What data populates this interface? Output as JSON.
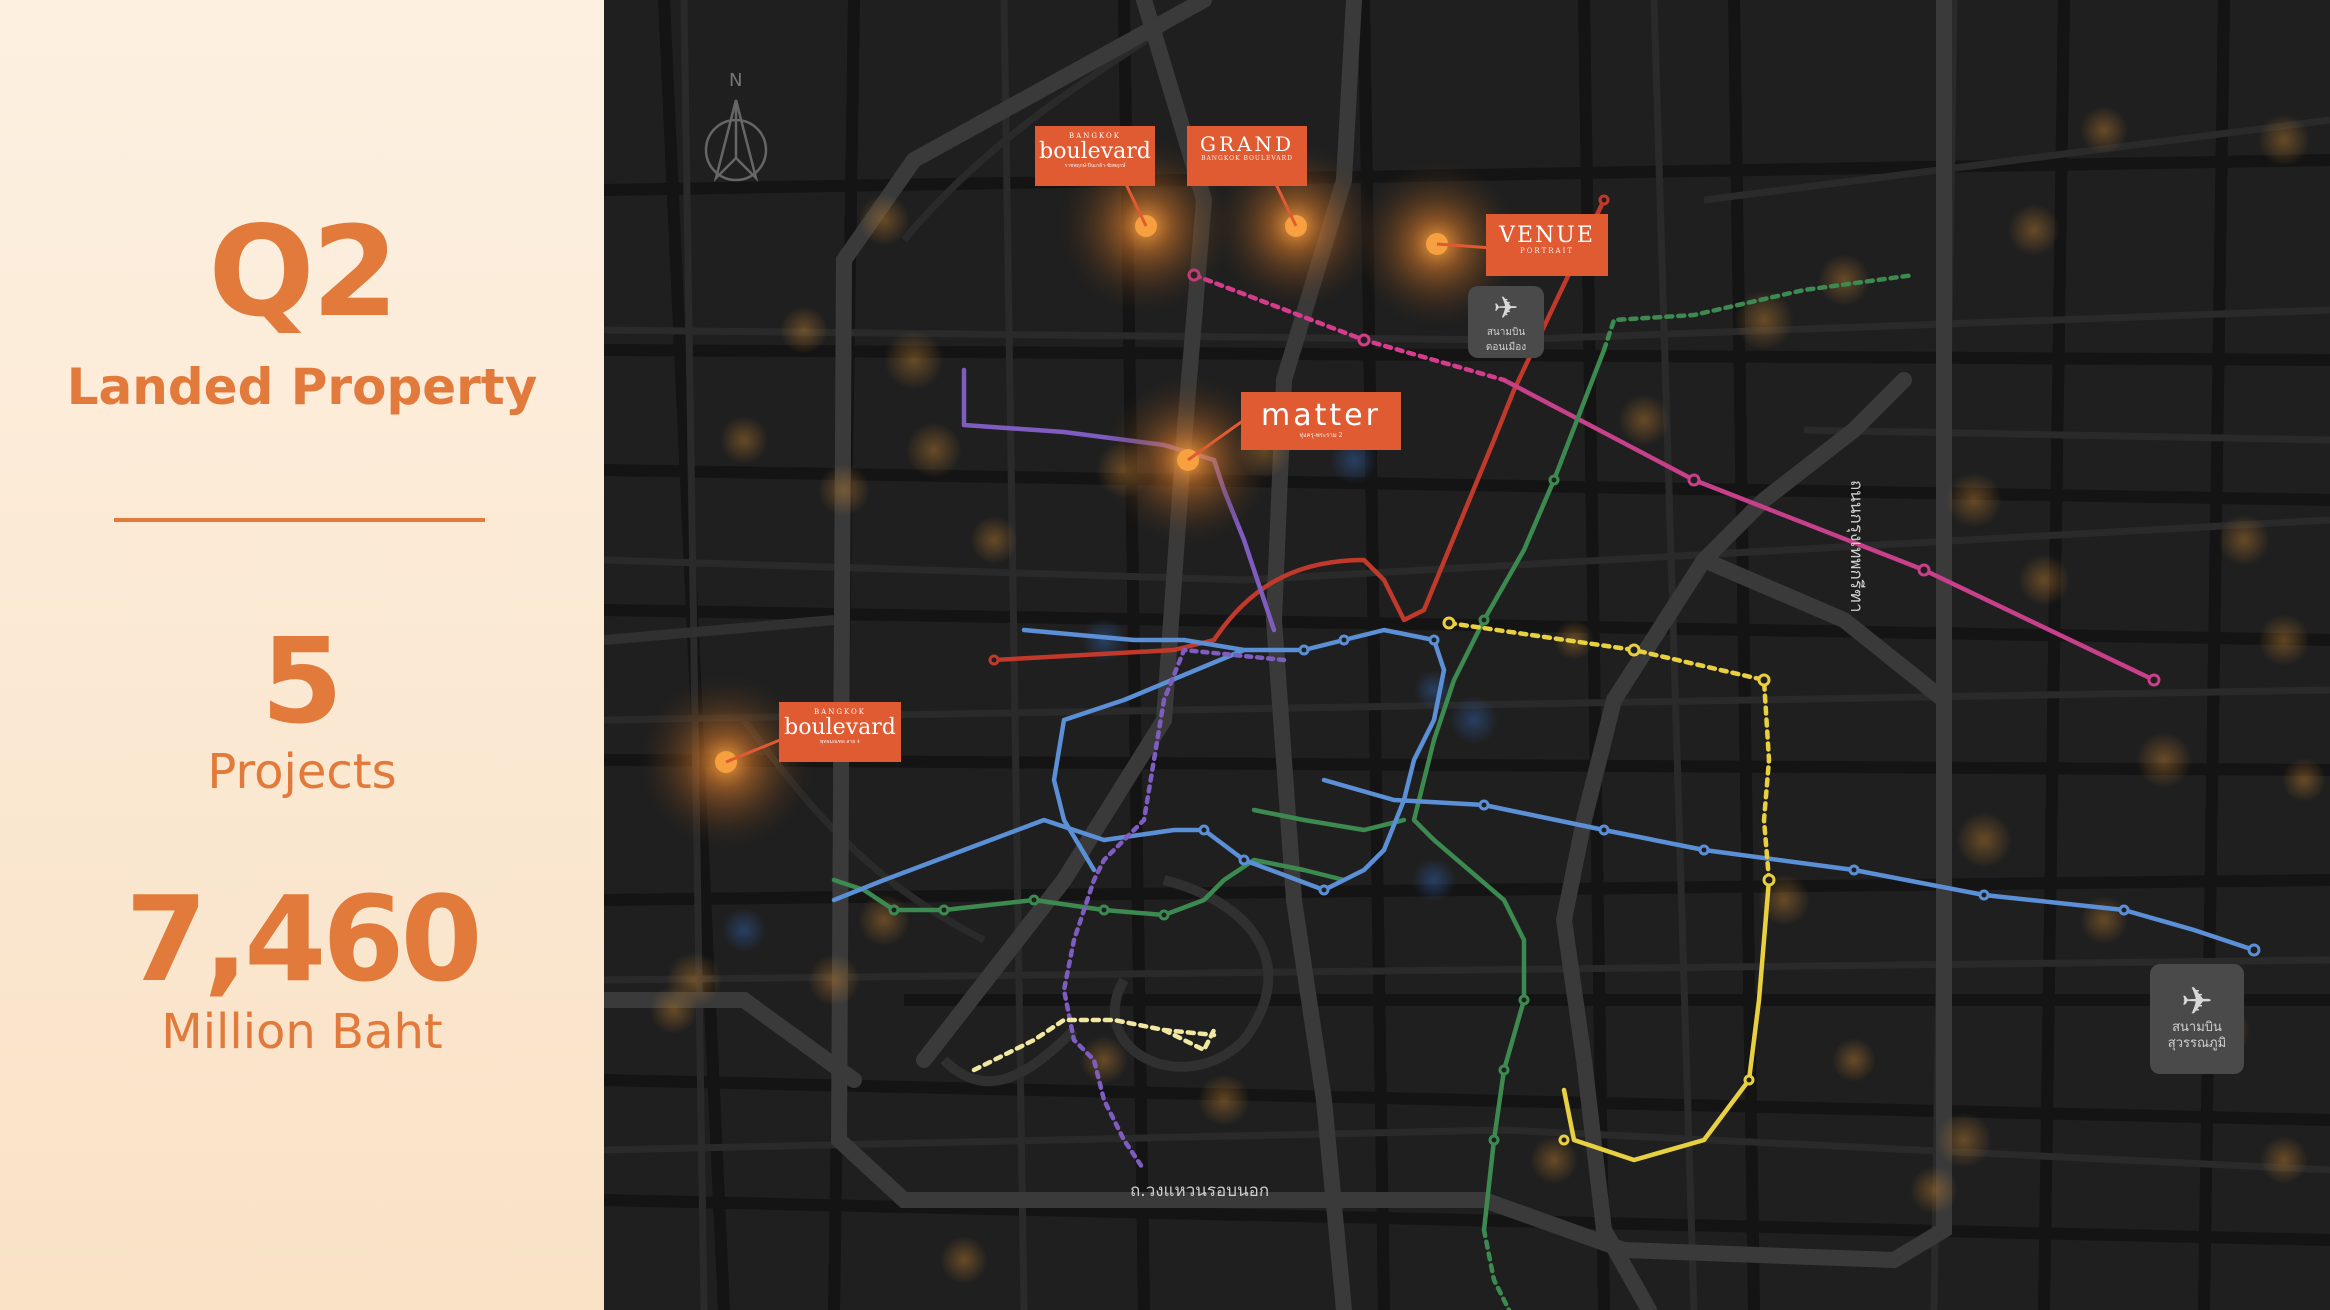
{
  "summary": {
    "quarter": "Q2",
    "category": "Landed Property",
    "project_count": "5",
    "project_label": "Projects",
    "value": "7,460",
    "value_unit": "Million Baht"
  },
  "map": {
    "compass_label": "N",
    "road_labels": {
      "outer_ring": "ถ.วงแหวนรอบนอก",
      "east_road": "ถนนกรุงเทพกรีฑา"
    },
    "airports": [
      {
        "name": "สนามบินดอนเมือง"
      },
      {
        "name": "สนามบินสุวรรณภูมิ"
      }
    ],
    "projects": [
      {
        "brand_small": "BANGKOK",
        "brand": "boulevard",
        "sub": "ราชพฤกษ์-ปิ่นเกล้า-ชัยพฤกษ์"
      },
      {
        "brand_small": "",
        "brand": "GRAND",
        "sub": "BANGKOK BOULEVARD"
      },
      {
        "brand_small": "",
        "brand": "VENUE",
        "sub": "PORTRAIT"
      },
      {
        "brand_small": "",
        "brand": "matter",
        "sub": "ทุ่งครุ-พระราม 2"
      },
      {
        "brand_small": "BANGKOK",
        "brand": "boulevard",
        "sub": "พุทธมณฑล สาย 4"
      }
    ],
    "colors": {
      "marker": "#e05a32",
      "glow": "#f08a3a",
      "line_red": "#c0392b",
      "line_blue": "#5b8fd6",
      "line_green": "#3c8a50",
      "line_purple": "#7f5cc0",
      "line_magenta": "#c8408a",
      "line_yellow": "#e8d040",
      "line_pink_dotted": "#d63c8c"
    }
  }
}
